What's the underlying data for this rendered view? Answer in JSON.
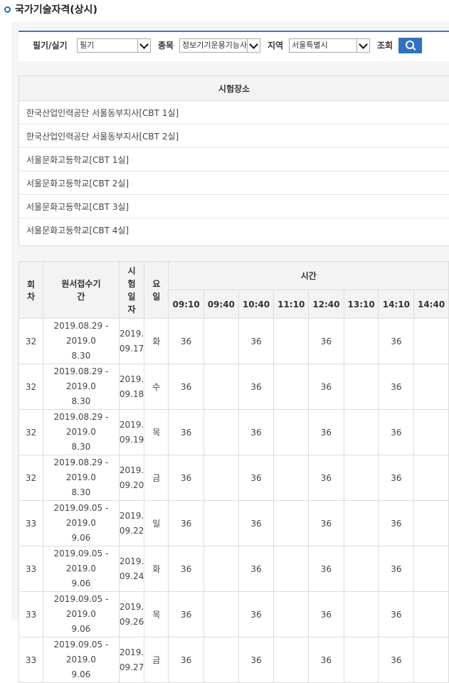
{
  "page": {
    "title": "국가기술자격(상시)"
  },
  "search": {
    "type_label": "필기/실기",
    "type_value": "필기",
    "item_label": "종목",
    "item_value": "정보기기운용기능사",
    "region_label": "지역",
    "region_value": "서울특별시",
    "search_label": "조회"
  },
  "locations": {
    "header": "시험장소",
    "items": [
      "한국산업인력공단 서울동부지사[CBT 1실]",
      "한국산업인력공단 서울동부지사[CBT 2실]",
      "서울문화고등학교[CBT 1실]",
      "서울문화고등학교[CBT 2실]",
      "서울문화고등학교[CBT 3실]",
      "서울문화고등학교[CBT 4실]"
    ]
  },
  "schedule": {
    "headers": {
      "round": "회차",
      "period": "원서접수기간",
      "date": "시험일자",
      "day": "요일",
      "time": "시간"
    },
    "times": [
      "09:10",
      "09:40",
      "10:40",
      "11:10",
      "12:40",
      "13:10",
      "14:10",
      "14:40"
    ],
    "rows": [
      {
        "round": "32",
        "period_a": "2019.08.29 - 2019.0",
        "period_b": "8.30",
        "date_a": "2019.",
        "date_b": "09.17",
        "day": "화",
        "cells": [
          "36",
          "",
          "36",
          "",
          "36",
          "",
          "36",
          ""
        ]
      },
      {
        "round": "32",
        "period_a": "2019.08.29 - 2019.0",
        "period_b": "8.30",
        "date_a": "2019.",
        "date_b": "09.18",
        "day": "수",
        "cells": [
          "36",
          "",
          "36",
          "",
          "36",
          "",
          "36",
          ""
        ]
      },
      {
        "round": "32",
        "period_a": "2019.08.29 - 2019.0",
        "period_b": "8.30",
        "date_a": "2019.",
        "date_b": "09.19",
        "day": "목",
        "cells": [
          "36",
          "",
          "36",
          "",
          "36",
          "",
          "36",
          ""
        ]
      },
      {
        "round": "32",
        "period_a": "2019.08.29 - 2019.0",
        "period_b": "8.30",
        "date_a": "2019.",
        "date_b": "09.20",
        "day": "금",
        "cells": [
          "36",
          "",
          "36",
          "",
          "36",
          "",
          "36",
          ""
        ]
      },
      {
        "round": "33",
        "period_a": "2019.09.05 - 2019.0",
        "period_b": "9.06",
        "date_a": "2019.",
        "date_b": "09.22",
        "day": "일",
        "cells": [
          "36",
          "",
          "36",
          "",
          "36",
          "",
          "36",
          ""
        ]
      },
      {
        "round": "33",
        "period_a": "2019.09.05 - 2019.0",
        "period_b": "9.06",
        "date_a": "2019.",
        "date_b": "09.24",
        "day": "화",
        "cells": [
          "36",
          "",
          "36",
          "",
          "36",
          "",
          "36",
          ""
        ]
      },
      {
        "round": "33",
        "period_a": "2019.09.05 - 2019.0",
        "period_b": "9.06",
        "date_a": "2019.",
        "date_b": "09.26",
        "day": "목",
        "cells": [
          "36",
          "",
          "36",
          "",
          "36",
          "",
          "36",
          ""
        ]
      },
      {
        "round": "33",
        "period_a": "2019.09.05 - 2019.0",
        "period_b": "9.06",
        "date_a": "2019.",
        "date_b": "09.27",
        "day": "금",
        "cells": [
          "36",
          "",
          "36",
          "",
          "36",
          "",
          "36",
          ""
        ]
      }
    ]
  },
  "colors": {
    "accent": "#2f72c0",
    "header_bg": "#f3f3f3",
    "border": "#dcdcdc"
  },
  "icons": {
    "search": "search-icon",
    "title_bullet": "circle-bullet-icon"
  }
}
